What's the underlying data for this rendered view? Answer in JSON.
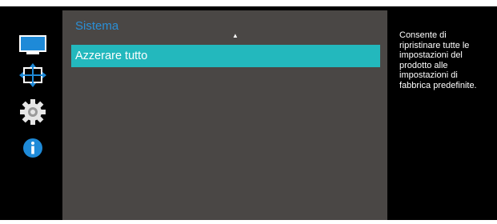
{
  "icons": [
    {
      "name": "monitor-icon"
    },
    {
      "name": "resize-arrows-icon"
    },
    {
      "name": "gear-icon"
    },
    {
      "name": "info-icon"
    }
  ],
  "menu": {
    "title": "Sistema",
    "scroll_up_indicator": "▲",
    "items": [
      {
        "label": "Azzerare tutto",
        "selected": true
      }
    ]
  },
  "help": {
    "lines": [
      "Consente di",
      "ripristinare tutte le",
      "impostazioni del",
      "prodotto alle",
      "impostazioni di",
      "fabbrica predefinite."
    ]
  },
  "colors": {
    "title_blue": "#2b8fd6",
    "highlight_teal": "#23b8bd",
    "panel_gray": "#4a4745",
    "background_black": "#000000"
  }
}
